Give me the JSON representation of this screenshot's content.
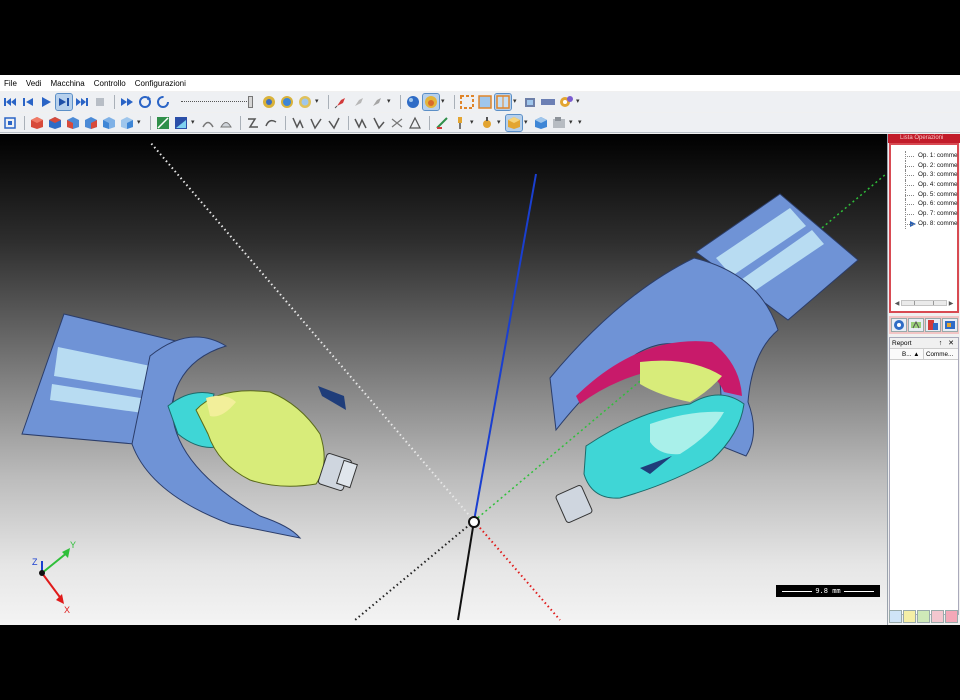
{
  "menu": [
    "File",
    "Vedi",
    "Macchina",
    "Controllo",
    "Configurazioni"
  ],
  "toolbar_row1": {
    "playback": [
      "skip-start-icon",
      "step-back-icon",
      "play-icon",
      "step-forward-icon",
      "skip-end-icon",
      "stop-icon",
      "fast-forward-icon",
      "rewind-cycle-icon",
      "refresh-icon"
    ],
    "active_button": "step-forward-icon",
    "speed_slider_level": 1.0
  },
  "viewport": {
    "scale_label": "9.8 mm",
    "triad": {
      "x": "X",
      "y": "Y",
      "z": "Z"
    }
  },
  "operations_panel": {
    "title": "Lista Operazioni",
    "items": [
      "Op. 1: comme",
      "Op. 2: comme",
      "Op. 3: comme",
      "Op. 4: comme",
      "Op. 5: comme",
      "Op. 6: comme",
      "Op. 7: comme",
      "Op. 8: comme"
    ],
    "current_index": 7
  },
  "report": {
    "title": "Report",
    "controls": "↑ ✕",
    "columns": [
      "B...",
      "Comme..."
    ]
  },
  "colors": {
    "accent_red": "#c21c2a",
    "part_blue": "#6f93d6",
    "stock_yellow": "#d8ec7a",
    "stock_cyan": "#3fd6d6"
  },
  "swatch_colors": [
    "#cfe4f7",
    "#f5efa6",
    "#cfe9b8",
    "#f3c7cf",
    "#f4a8b8"
  ]
}
